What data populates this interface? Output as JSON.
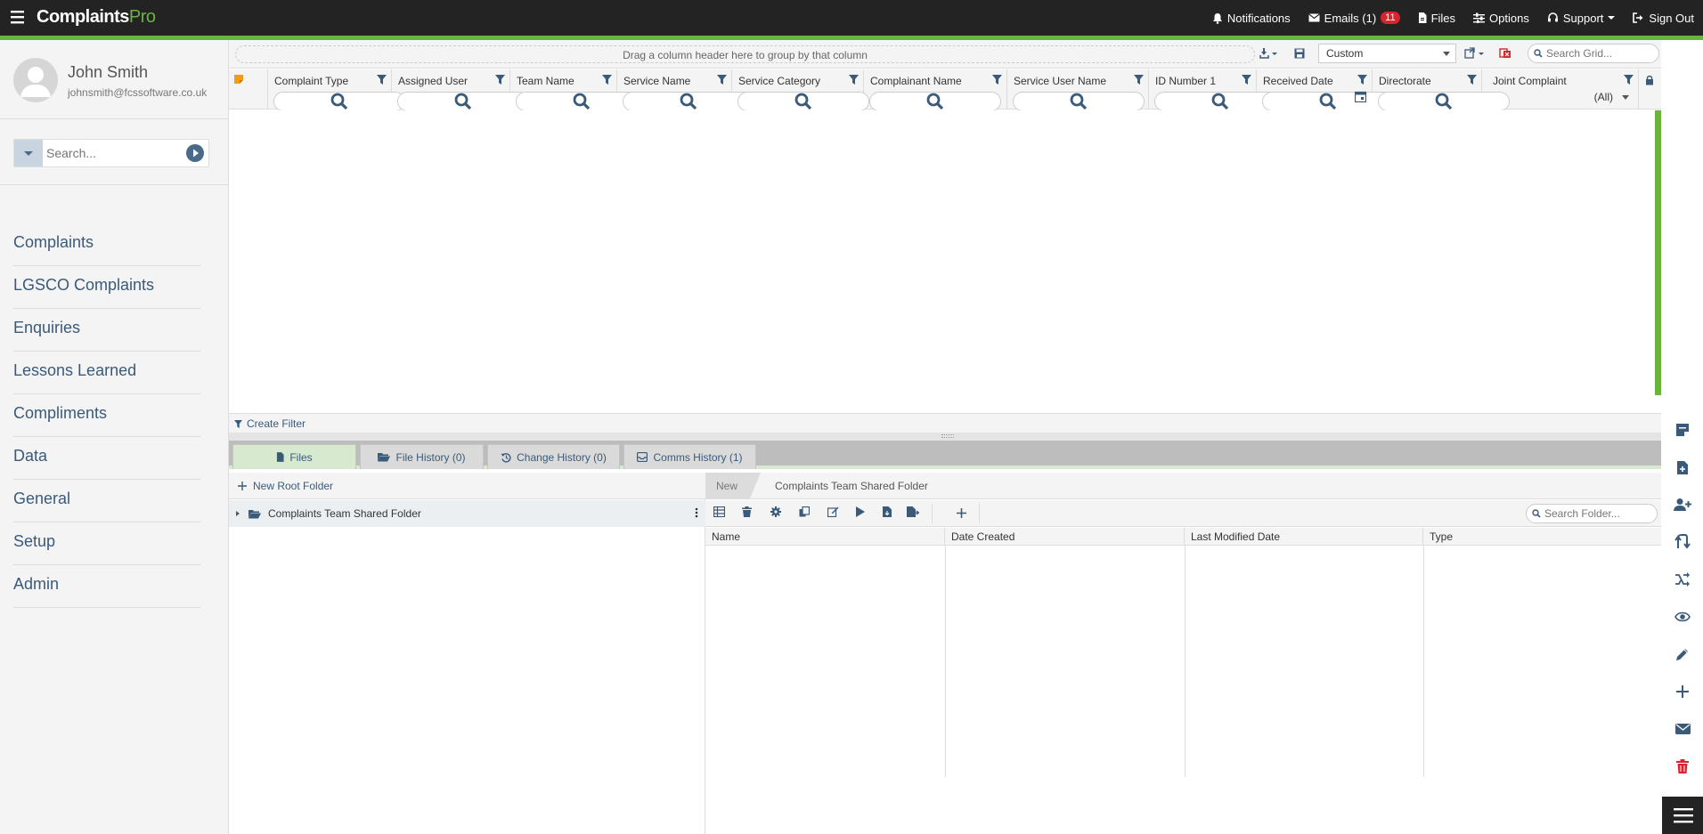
{
  "app": {
    "brand_main": "Complaints",
    "brand_accent": "Pro"
  },
  "topnav": {
    "notifications": "Notifications",
    "emails": "Emails (1)",
    "emails_badge": "11",
    "files": "Files",
    "options": "Options",
    "support": "Support",
    "signout": "Sign Out"
  },
  "user": {
    "name": "John Smith",
    "email": "johnsmith@fcssoftware.co.uk"
  },
  "sidebar": {
    "search_placeholder": "Search...",
    "items": [
      {
        "label": "Complaints"
      },
      {
        "label": "LGSCO Complaints"
      },
      {
        "label": "Enquiries"
      },
      {
        "label": "Lessons Learned"
      },
      {
        "label": "Compliments"
      },
      {
        "label": "Data"
      },
      {
        "label": "General"
      },
      {
        "label": "Setup"
      },
      {
        "label": "Admin"
      }
    ]
  },
  "grid": {
    "group_hint": "Drag a column header here to group by that column",
    "layout": "Custom",
    "search_placeholder": "Search Grid...",
    "columns": [
      {
        "label": "Complaint Type"
      },
      {
        "label": "Assigned User"
      },
      {
        "label": "Team Name"
      },
      {
        "label": "Service Name"
      },
      {
        "label": "Service Category"
      },
      {
        "label": "Complainant Name"
      },
      {
        "label": "Service User Name"
      },
      {
        "label": "ID Number 1"
      },
      {
        "label": "Received Date"
      },
      {
        "label": "Directorate"
      },
      {
        "label": "Joint Complaint"
      }
    ],
    "joint_filter_value": "(All)",
    "create_filter": "Create Filter"
  },
  "tabs": [
    {
      "label": "Files"
    },
    {
      "label": "File History  (0)"
    },
    {
      "label": "Change History  (0)"
    },
    {
      "label": "Comms History  (1)"
    }
  ],
  "files": {
    "new_root_folder": "New Root Folder",
    "tree_node": "Complaints Team Shared Folder",
    "breadcrumb_new": "New",
    "breadcrumb_folder": "Complaints Team Shared Folder",
    "search_placeholder": "Search Folder...",
    "columns": [
      {
        "label": "Name"
      },
      {
        "label": "Date Created"
      },
      {
        "label": "Last Modified Date"
      },
      {
        "label": "Type"
      }
    ]
  },
  "colors": {
    "topbar": "#232323",
    "accent_green": "#6ab43e",
    "link_blue": "#3a5a7a",
    "badge_red": "#d9232d"
  },
  "icons": [
    "hamburger-icon",
    "bell-icon",
    "envelope-icon",
    "file-icon",
    "sliders-icon",
    "headset-icon",
    "sign-out-icon",
    "search-icon",
    "filter-icon",
    "calendar-icon",
    "lock-icon",
    "folder-open-icon",
    "kebab-icon",
    "plus-icon"
  ]
}
